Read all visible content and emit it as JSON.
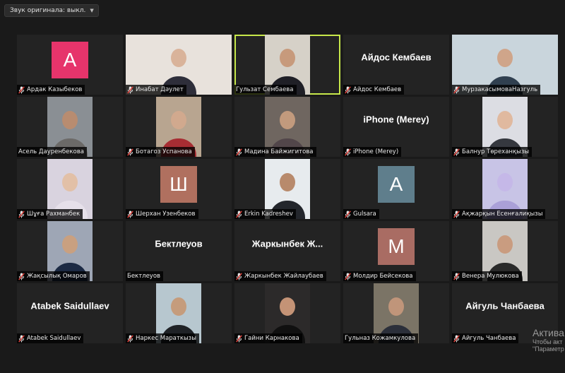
{
  "toolbar": {
    "audio_button_label": "Звук оригинала: выкл."
  },
  "colors": {
    "active_speaker_border": "#c7e84a",
    "muted_icon": "#e0403a"
  },
  "participants": [
    {
      "name": "Ардак Казыбеков",
      "display": "avatar",
      "initial": "A",
      "avatar_color": "#e6346b",
      "muted": true
    },
    {
      "name": "Инабат Дәулет",
      "display": "video",
      "muted": true
    },
    {
      "name": "Гульзат Сембаева",
      "display": "video",
      "muted": false,
      "active_speaker": true
    },
    {
      "name": "Айдос Кембаев",
      "display": "name",
      "big_name": "Айдос Кембаев",
      "muted": true
    },
    {
      "name": "МурзакасымоваНазгуль",
      "display": "video",
      "muted": true
    },
    {
      "name": "Асель Дауренбекова",
      "display": "video",
      "muted": false
    },
    {
      "name": "Ботагоз Успанова",
      "display": "video",
      "muted": true
    },
    {
      "name": "Мадина Байжигитова",
      "display": "video",
      "muted": true
    },
    {
      "name": "iPhone (Merey)",
      "display": "name",
      "big_name": "iPhone (Merey)",
      "muted": true
    },
    {
      "name": "Балнур Төреханқызы",
      "display": "video",
      "muted": true
    },
    {
      "name": "Шұға Рахманбек",
      "display": "video",
      "muted": true
    },
    {
      "name": "Шерхан Узенбеков",
      "display": "avatar",
      "initial": "Ш",
      "avatar_color": "#b0705f",
      "muted": true
    },
    {
      "name": "Erkin Kadreshev",
      "display": "video",
      "muted": true
    },
    {
      "name": "Gulsara",
      "display": "avatar",
      "initial": "A",
      "avatar_color": "#5f7e8c",
      "muted": true
    },
    {
      "name": "Ақжарқын Есенғалиқызы",
      "display": "video",
      "muted": true
    },
    {
      "name": "Жақсылық Омаров",
      "display": "video",
      "muted": true
    },
    {
      "name": "Бектлеуов",
      "display": "name",
      "big_name": "Бектлеуов",
      "muted": false
    },
    {
      "name": "Жаркынбек Жайлаубаев",
      "display": "name",
      "big_name": "Жаркынбек Ж...",
      "muted": true
    },
    {
      "name": "Молдир Бейсекова",
      "display": "avatar",
      "initial": "M",
      "avatar_color": "#a96c63",
      "muted": true
    },
    {
      "name": "Венера Мулюкова",
      "display": "video",
      "muted": true
    },
    {
      "name": "Atabek Saidullaev",
      "display": "name",
      "big_name": "Atabek Saidullaev",
      "muted": true
    },
    {
      "name": "Наркес Мараткызы",
      "display": "video",
      "muted": true
    },
    {
      "name": "Гайни Карнакова",
      "display": "video",
      "muted": true
    },
    {
      "name": "Гульназ Кожамкулова",
      "display": "video",
      "muted": false
    },
    {
      "name": "Айгуль Чанбаева",
      "display": "name",
      "big_name": "Айгуль Чанбаева",
      "muted": true
    }
  ],
  "watermark": {
    "line1": "Актива",
    "line2": "Чтобы акт",
    "line3": "\"Параметр"
  }
}
